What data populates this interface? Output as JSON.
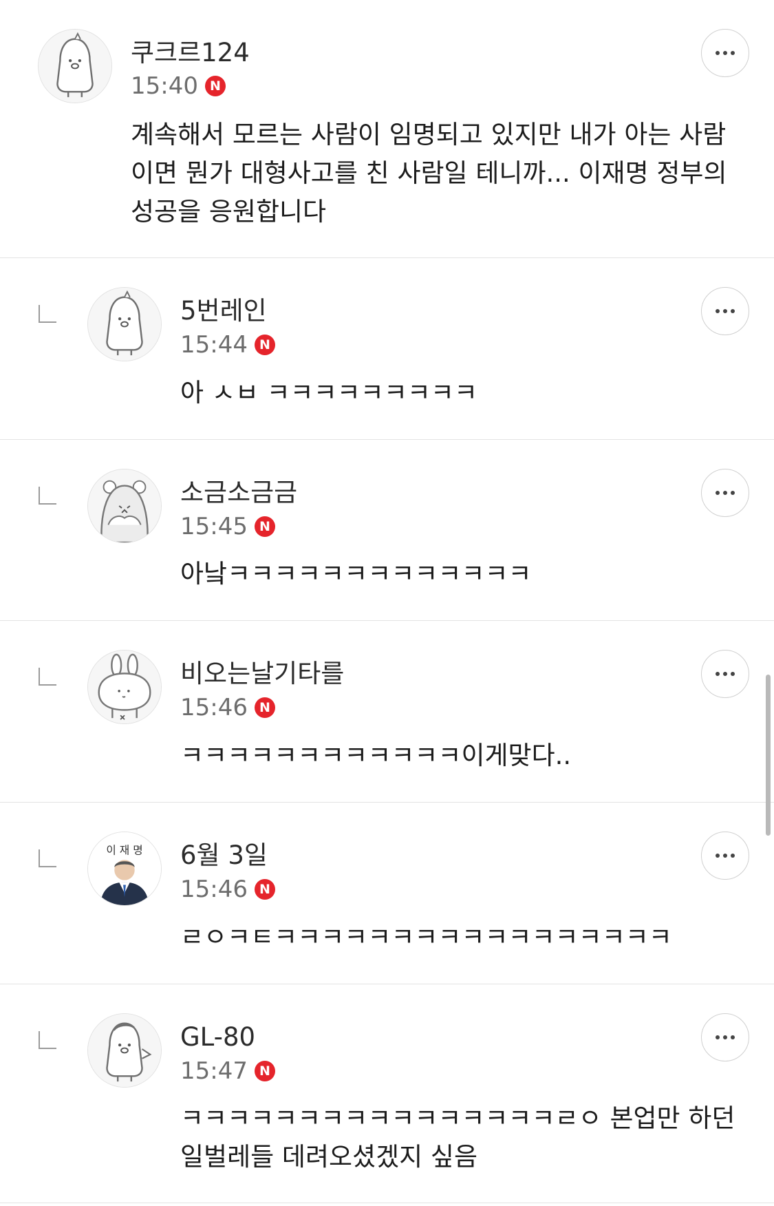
{
  "comments": [
    {
      "nickname": "쿠크르124",
      "time": "15:40",
      "badge": "N",
      "avatar_icon": "penguin-avatar-icon",
      "text": "계속해서 모르는 사람이 임명되고 있지만 내가 아는 사람이면 뭔가 대형사고를 친 사람일 테니까... 이재명 정부의 성공을 응원합니다"
    },
    {
      "nickname": "5번레인",
      "time": "15:44",
      "badge": "N",
      "avatar_icon": "penguin-avatar-icon",
      "text": "아 ㅅㅂ ㅋㅋㅋㅋㅋㅋㅋㅋㅋ"
    },
    {
      "nickname": "소금소금금",
      "time": "15:45",
      "badge": "N",
      "avatar_icon": "hamster-avatar-icon",
      "text": "아낰ㅋㅋㅋㅋㅋㅋㅋㅋㅋㅋㅋㅋㅋ"
    },
    {
      "nickname": "비오는날기타를",
      "time": "15:46",
      "badge": "N",
      "avatar_icon": "rabbit-avatar-icon",
      "text": "ㅋㅋㅋㅋㅋㅋㅋㅋㅋㅋㅋㅋ이게맞다.."
    },
    {
      "nickname": "6월 3일",
      "time": "15:46",
      "badge": "N",
      "avatar_icon": "portrait-avatar-icon",
      "avatar_caption": "이 재 명",
      "text": "ㄹㅇㅋㅌㅋㅋㅋㅋㅋㅋㅋㅋㅋㅋㅋㅋㅋㅋㅋㅋㅋ"
    },
    {
      "nickname": "GL-80",
      "time": "15:47",
      "badge": "N",
      "avatar_icon": "penguin-avatar-icon",
      "text": "ㅋㅋㅋㅋㅋㅋㅋㅋㅋㅋㅋㅋㅋㅋㅋㅋㄹㅇ 본업만 하던 일벌레들 데려오셨겠지 싶음"
    }
  ],
  "colors": {
    "badge": "#e5242b",
    "divider": "#e3e3e3",
    "time_text": "#6d6d6d"
  }
}
